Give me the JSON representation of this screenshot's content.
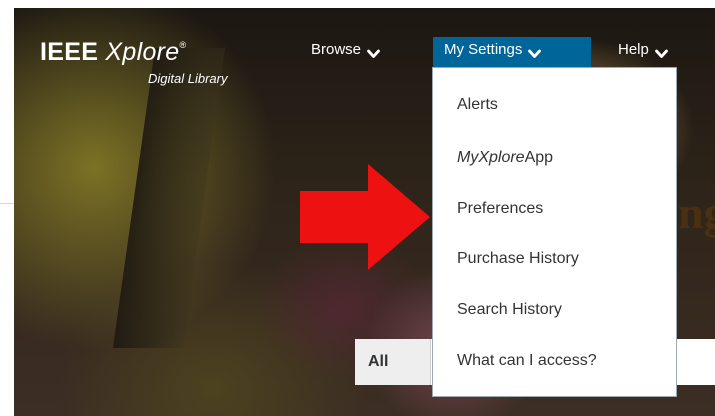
{
  "logo": {
    "brand": "IEEE",
    "product": "Xplore",
    "registered": "®",
    "subtitle": "Digital Library"
  },
  "nav": {
    "browse": "Browse",
    "settings": "My Settings",
    "help": "Help"
  },
  "dropdown": {
    "items": [
      {
        "label": "Alerts"
      },
      {
        "label_italic": "MyXplore",
        "label": "App"
      },
      {
        "label": "Preferences"
      },
      {
        "label": "Purchase History"
      },
      {
        "label": "Search History"
      },
      {
        "label": "What can I access?"
      }
    ]
  },
  "hero": {
    "partial_text": "ng"
  },
  "search": {
    "scope": "All"
  },
  "colors": {
    "nav_active": "#006699",
    "arrow": "#ee1111",
    "menu_text": "#333333"
  }
}
